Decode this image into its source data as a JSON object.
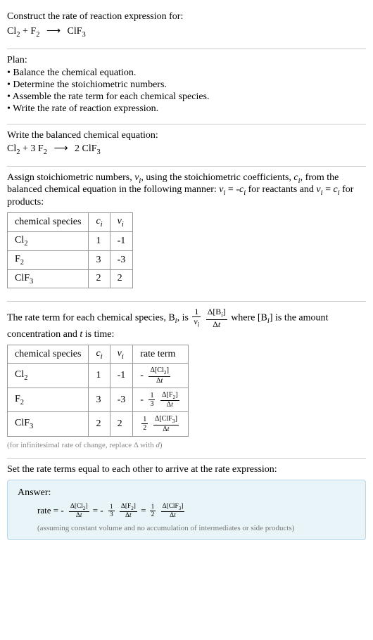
{
  "intro": {
    "prompt": "Construct the rate of reaction expression for:",
    "equation_left_a": "Cl",
    "equation_left_a_sub": "2",
    "equation_plus": " + ",
    "equation_left_b": "F",
    "equation_left_b_sub": "2",
    "equation_arrow": "⟶",
    "equation_right": "ClF",
    "equation_right_sub": "3"
  },
  "plan": {
    "title": "Plan:",
    "items": [
      "• Balance the chemical equation.",
      "• Determine the stoichiometric numbers.",
      "• Assemble the rate term for each chemical species.",
      "• Write the rate of reaction expression."
    ]
  },
  "balanced": {
    "title": "Write the balanced chemical equation:",
    "lhs_a": "Cl",
    "lhs_a_sub": "2",
    "plus": " + ",
    "coef_b": "3 ",
    "lhs_b": "F",
    "lhs_b_sub": "2",
    "arrow": "⟶",
    "coef_r": "2 ",
    "rhs": "ClF",
    "rhs_sub": "3"
  },
  "stoich": {
    "text_1": "Assign stoichiometric numbers, ",
    "nu_i": "ν",
    "nu_i_sub": "i",
    "text_2": ", using the stoichiometric coefficients, ",
    "c_i": "c",
    "c_i_sub": "i",
    "text_3": ", from the balanced chemical equation in the following manner: ",
    "rel_reac": " = -",
    "text_4": " for reactants and ",
    "rel_prod": " = ",
    "text_5": " for products:",
    "headers": {
      "species": "chemical species",
      "ci": "c",
      "ci_sub": "i",
      "nui": "ν",
      "nui_sub": "i"
    },
    "rows": [
      {
        "name": "Cl",
        "name_sub": "2",
        "ci": "1",
        "nui": "-1"
      },
      {
        "name": "F",
        "name_sub": "2",
        "ci": "3",
        "nui": "-3"
      },
      {
        "name": "ClF",
        "name_sub": "3",
        "ci": "2",
        "nui": "2"
      }
    ]
  },
  "rateterm": {
    "text_1": "The rate term for each chemical species, B",
    "Bi_sub": "i",
    "text_2": ", is ",
    "frac1_num": "1",
    "frac1_den_a": "ν",
    "frac1_den_sub": "i",
    "frac2_num_a": "Δ[B",
    "frac2_num_sub": "i",
    "frac2_num_b": "]",
    "frac2_den_a": "Δ",
    "frac2_den_b": "t",
    "text_3": " where [B",
    "text_3_sub": "i",
    "text_4": "] is the amount concentration and ",
    "t": "t",
    "text_5": " is time:",
    "headers": {
      "species": "chemical species",
      "ci": "c",
      "ci_sub": "i",
      "nui": "ν",
      "nui_sub": "i",
      "rate": "rate term"
    },
    "rows": [
      {
        "name": "Cl",
        "name_sub": "2",
        "ci": "1",
        "nui": "-1",
        "neg": "-",
        "coef_num": "",
        "coef_den": "",
        "rt_num_a": "Δ[Cl",
        "rt_num_sub": "2",
        "rt_num_b": "]",
        "rt_den_a": "Δ",
        "rt_den_b": "t"
      },
      {
        "name": "F",
        "name_sub": "2",
        "ci": "3",
        "nui": "-3",
        "neg": "-",
        "coef_num": "1",
        "coef_den": "3",
        "rt_num_a": "Δ[F",
        "rt_num_sub": "2",
        "rt_num_b": "]",
        "rt_den_a": "Δ",
        "rt_den_b": "t"
      },
      {
        "name": "ClF",
        "name_sub": "3",
        "ci": "2",
        "nui": "2",
        "neg": "",
        "coef_num": "1",
        "coef_den": "2",
        "rt_num_a": "Δ[ClF",
        "rt_num_sub": "3",
        "rt_num_b": "]",
        "rt_den_a": "Δ",
        "rt_den_b": "t"
      }
    ],
    "footnote": "(for infinitesimal rate of change, replace Δ with ",
    "footnote_d": "d",
    "footnote_end": ")"
  },
  "final": {
    "title": "Set the rate terms equal to each other to arrive at the rate expression:"
  },
  "answer": {
    "label": "Answer:",
    "rate": "rate",
    "eq": " = ",
    "neg": "-",
    "t1_num_a": "Δ[Cl",
    "t1_num_sub": "2",
    "t1_num_b": "]",
    "t1_den_a": "Δ",
    "t1_den_b": "t",
    "c2_num": "1",
    "c2_den": "3",
    "t2_num_a": "Δ[F",
    "t2_num_sub": "2",
    "t2_num_b": "]",
    "t2_den_a": "Δ",
    "t2_den_b": "t",
    "c3_num": "1",
    "c3_den": "2",
    "t3_num_a": "Δ[ClF",
    "t3_num_sub": "3",
    "t3_num_b": "]",
    "t3_den_a": "Δ",
    "t3_den_b": "t",
    "note": "(assuming constant volume and no accumulation of intermediates or side products)"
  }
}
